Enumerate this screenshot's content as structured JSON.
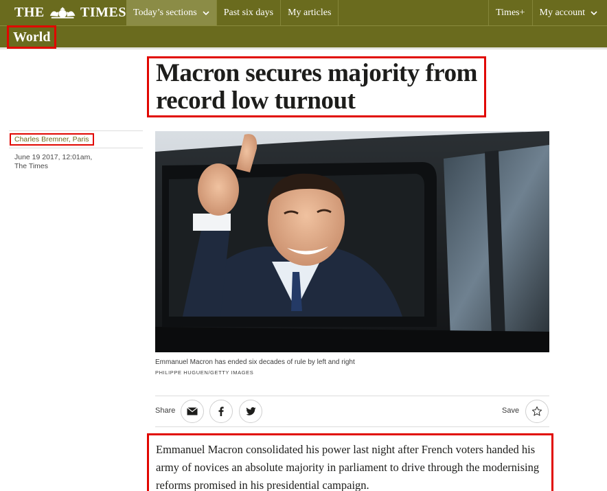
{
  "header": {
    "masthead_left": "THE",
    "masthead_right": "TIMES",
    "nav": {
      "todays_sections": "Today’s sections",
      "past_six_days": "Past six days",
      "my_articles": "My articles",
      "times_plus": "Times+",
      "my_account": "My account"
    }
  },
  "section": {
    "label": "World"
  },
  "article": {
    "headline": "Macron secures majority from record low turnout",
    "author": "Charles Bremner, Paris",
    "date": "June 19 2017, 12:01am,",
    "publication": "The Times",
    "image_caption": "Emmanuel Macron has ended six decades of rule by left and right",
    "image_credit": "PHILIPPE HUGUEN/GETTY IMAGES",
    "body_first_paragraph": "Emmanuel Macron consolidated his power last night after French voters handed his army of novices an absolute majority in parliament to drive through the modernising reforms promised in his presidential campaign."
  },
  "share": {
    "share_label": "Share",
    "save_label": "Save",
    "icons": [
      "email-icon",
      "facebook-icon",
      "twitter-icon",
      "star-icon"
    ]
  },
  "colors": {
    "nav_background": "#6a6b1e",
    "nav_active": "#8b8c46",
    "highlight": "#e10600",
    "author_link": "#6a6b1e"
  }
}
